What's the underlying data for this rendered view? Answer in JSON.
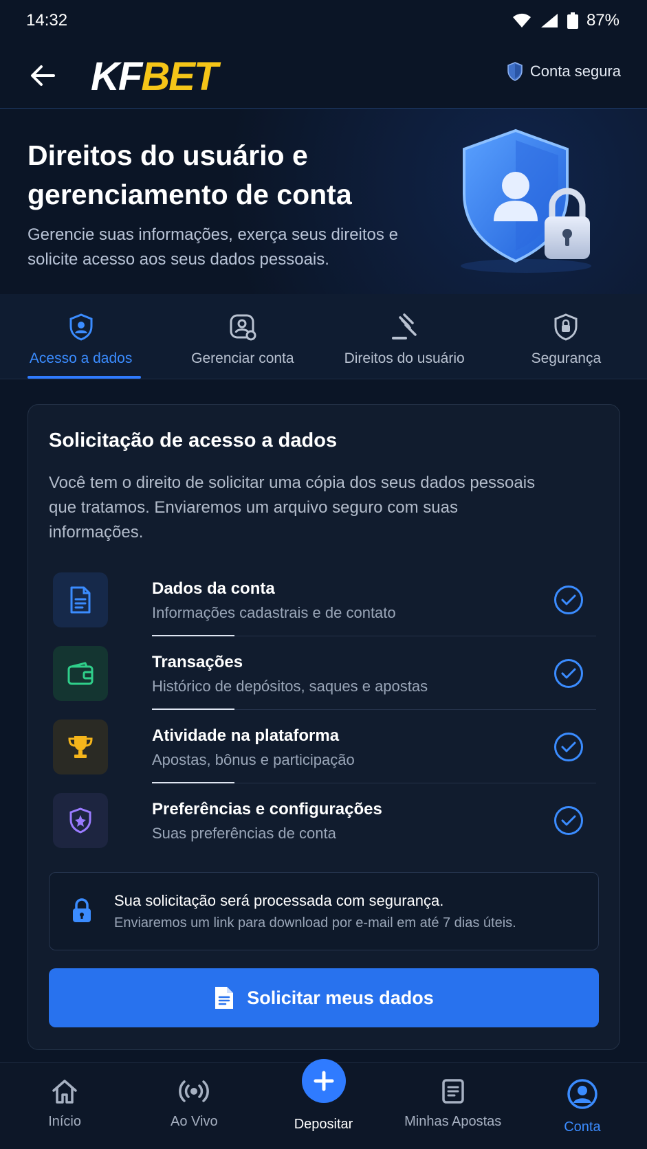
{
  "status_bar": {
    "time": "14:32",
    "battery": "87%"
  },
  "header": {
    "logo_part1": "KF",
    "logo_part2": "BET",
    "secure_label": "Conta segura"
  },
  "hero": {
    "title": "Direitos do usuário e gerenciamento de conta",
    "subtitle": "Gerencie suas informações, exerça seus direitos e solicite acesso aos seus dados pessoais."
  },
  "tabs": [
    {
      "label": "Acesso a dados",
      "icon": "user-shield-icon",
      "active": true
    },
    {
      "label": "Gerenciar conta",
      "icon": "user-settings-icon",
      "active": false
    },
    {
      "label": "Direitos do usuário",
      "icon": "gavel-icon",
      "active": false
    },
    {
      "label": "Segurança",
      "icon": "lock-shield-icon",
      "active": false
    }
  ],
  "card": {
    "title": "Solicitação de acesso a dados",
    "description": "Você tem o direito de solicitar uma cópia dos seus dados pessoais que tratamos. Enviaremos um arquivo seguro com suas informações.",
    "items": [
      {
        "title": "Dados da conta",
        "subtitle": "Informações cadastrais e de contato",
        "icon": "document-icon",
        "color": "#3b8cff"
      },
      {
        "title": "Transações",
        "subtitle": "Histórico de depósitos, saques e apostas",
        "icon": "wallet-icon",
        "color": "#2fcf8a"
      },
      {
        "title": "Atividade na plataforma",
        "subtitle": "Apostas, bônus e participação",
        "icon": "trophy-icon",
        "color": "#f5b51b"
      },
      {
        "title": "Preferências e configurações",
        "subtitle": "Suas preferências de conta",
        "icon": "shield-star-icon",
        "color": "#9a7bff"
      }
    ],
    "notice_title": "Sua solicitação será processada com segurança.",
    "notice_subtitle": "Enviaremos um link para download por e-mail em até 7 dias úteis.",
    "cta_label": "Solicitar meus dados"
  },
  "bottom_nav": [
    {
      "label": "Início",
      "icon": "home-icon"
    },
    {
      "label": "Ao Vivo",
      "icon": "live-broadcast-icon"
    },
    {
      "label": "Depositar",
      "icon": "plus-icon"
    },
    {
      "label": "Minhas Apostas",
      "icon": "bet-slip-icon"
    },
    {
      "label": "Conta",
      "icon": "account-icon",
      "active": true
    }
  ],
  "colors": {
    "background": "#0b1526",
    "accent": "#2f7bff",
    "brand_yellow": "#f5c518"
  }
}
